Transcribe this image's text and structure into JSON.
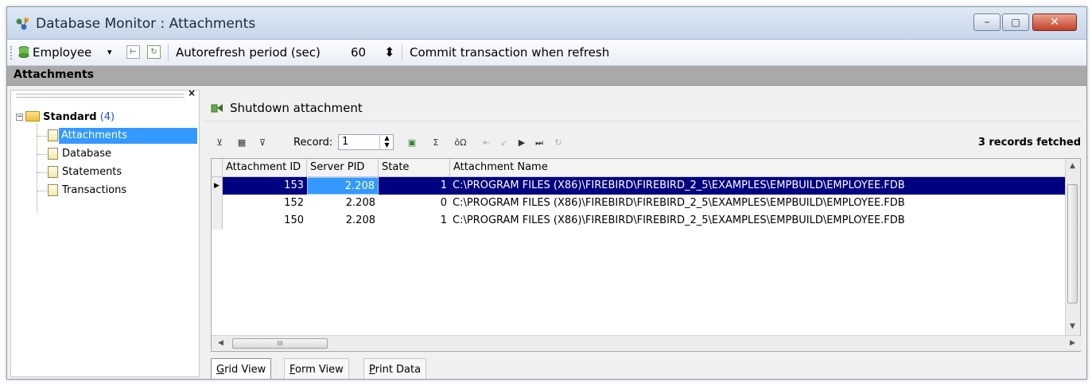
{
  "window": {
    "title": "Database Monitor : Attachments",
    "controls": {
      "minimize": "–",
      "maximize": "□",
      "close": "✕"
    }
  },
  "toolbar": {
    "database": "Employee",
    "dropdown_glyph": "▾",
    "autorefresh_label": "Autorefresh period (sec)",
    "autorefresh_value": "60",
    "spin_glyph": "⬍",
    "commit_label": "Commit transaction when refresh"
  },
  "section": {
    "title": "Attachments"
  },
  "tree": {
    "close_glyph": "×",
    "root": {
      "label": "Standard",
      "count": "(4)",
      "expander": "−"
    },
    "items": [
      {
        "label": "Attachments",
        "selected": true
      },
      {
        "label": "Database"
      },
      {
        "label": "Statements"
      },
      {
        "label": "Transactions"
      }
    ]
  },
  "actions": {
    "shutdown_label": "Shutdown attachment"
  },
  "navigator": {
    "record_label": "Record:",
    "record_value": "1",
    "sigma": "Σ",
    "omega": "ôΩ",
    "status": "3 records fetched"
  },
  "grid": {
    "columns": [
      "Attachment ID",
      "Server PID",
      "State",
      "Attachment Name"
    ],
    "rows": [
      {
        "id": "153",
        "pid": "2.208",
        "state": "1",
        "name": "C:\\PROGRAM FILES (X86)\\FIREBIRD\\FIREBIRD_2_5\\EXAMPLES\\EMPBUILD\\EMPLOYEE.FDB",
        "current": true
      },
      {
        "id": "152",
        "pid": "2.208",
        "state": "0",
        "name": "C:\\PROGRAM FILES (X86)\\FIREBIRD\\FIREBIRD_2_5\\EXAMPLES\\EMPBUILD\\EMPLOYEE.FDB"
      },
      {
        "id": "150",
        "pid": "2.208",
        "state": "1",
        "name": "C:\\PROGRAM FILES (X86)\\FIREBIRD\\FIREBIRD_2_5\\EXAMPLES\\EMPBUILD\\EMPLOYEE.FDB"
      }
    ],
    "row_indicator": "▶",
    "hscroll_grip": "III"
  },
  "tabs": {
    "grid_first": "G",
    "grid_rest": "rid View",
    "form_first": "F",
    "form_rest": "orm View",
    "print_first": "P",
    "print_rest": "rint Data"
  },
  "colors": {
    "selected_row": "#000080",
    "focus_cell": "#3399ff",
    "tree_selection": "#3399ff",
    "section_header": "#a9a9a9"
  }
}
